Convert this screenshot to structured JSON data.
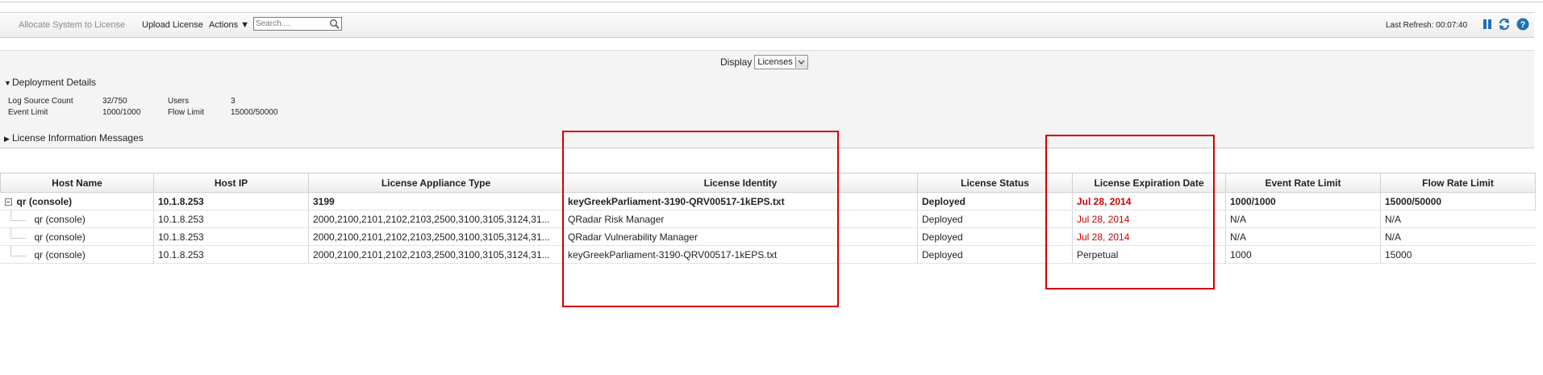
{
  "toolbar": {
    "allocate_label": "Allocate System to License",
    "upload_label": "Upload License",
    "actions_label": "Actions ▼",
    "search_placeholder": "Search....",
    "last_refresh_label": "Last Refresh: 00:07:40"
  },
  "display": {
    "label": "Display",
    "selected": "Licenses"
  },
  "deployment": {
    "title": "Deployment Details",
    "items": [
      {
        "label": "Log Source Count",
        "value": "32/750"
      },
      {
        "label": "Event Limit",
        "value": "1000/1000"
      },
      {
        "label": "Users",
        "value": "3"
      },
      {
        "label": "Flow Limit",
        "value": "15000/50000"
      }
    ]
  },
  "messages": {
    "title": "License Information Messages"
  },
  "table": {
    "columns": [
      "Host Name",
      "Host IP",
      "License Appliance Type",
      "License Identity",
      "License Status",
      "License Expiration Date",
      "Event Rate Limit",
      "Flow Rate Limit"
    ],
    "rows": [
      {
        "host": "qr (console)",
        "ip": "10.1.8.253",
        "type": "3199",
        "identity": "keyGreekParliament-3190-QRV00517-1kEPS.txt",
        "status": "Deployed",
        "expiration": "Jul 28, 2014",
        "event_rate": "1000/1000",
        "flow_rate": "15000/50000"
      },
      {
        "host": "qr (console)",
        "ip": "10.1.8.253",
        "type": "2000,2100,2101,2102,2103,2500,3100,3105,3124,31...",
        "identity": "QRadar Risk Manager",
        "status": "Deployed",
        "expiration": "Jul 28, 2014",
        "event_rate": "N/A",
        "flow_rate": "N/A"
      },
      {
        "host": "qr (console)",
        "ip": "10.1.8.253",
        "type": "2000,2100,2101,2102,2103,2500,3100,3105,3124,31...",
        "identity": "QRadar Vulnerability Manager",
        "status": "Deployed",
        "expiration": "Jul 28, 2014",
        "event_rate": "N/A",
        "flow_rate": "N/A"
      },
      {
        "host": "qr (console)",
        "ip": "10.1.8.253",
        "type": "2000,2100,2101,2102,2103,2500,3100,3105,3124,31...",
        "identity": "keyGreekParliament-3190-QRV00517-1kEPS.txt",
        "status": "Deployed",
        "expiration": "Perpetual",
        "event_rate": "1000",
        "flow_rate": "15000"
      }
    ]
  },
  "icons": {
    "pause": "pause-icon",
    "refresh": "refresh-icon",
    "help": "help-icon",
    "search": "search-icon"
  },
  "colors": {
    "accent_blue": "#1f6fb5",
    "expiration_red": "#cc0000",
    "highlight_red": "#d40000"
  }
}
